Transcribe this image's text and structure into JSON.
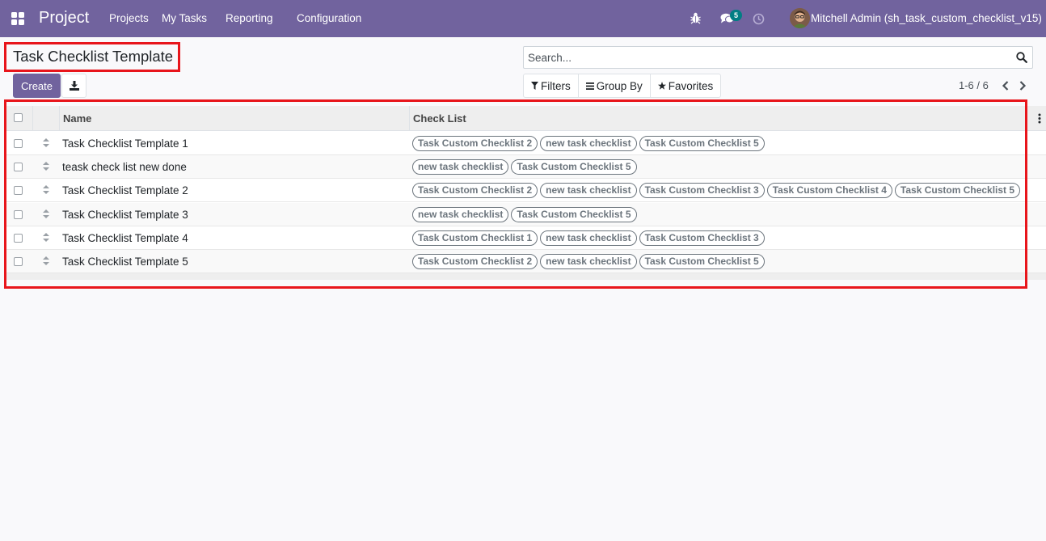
{
  "navbar": {
    "app_name": "Project",
    "menu": [
      "Projects",
      "My Tasks",
      "Reporting",
      "Configuration"
    ],
    "icons": [
      "apps-grid-icon",
      "bug-icon",
      "chat-icon",
      "clock-icon"
    ],
    "messages_badge": "5",
    "user": "Mitchell Admin (sh_task_custom_checklist_v15)",
    "bg_color": "#71639e"
  },
  "control": {
    "title": "Task Checklist Template",
    "create_label": "Create",
    "search_placeholder": "Search...",
    "filters_label": "Filters",
    "groupby_label": "Group By",
    "favorites_label": "Favorites",
    "pager": "1-6 / 6"
  },
  "table": {
    "headers": [
      "Name",
      "Check List"
    ],
    "rows": [
      {
        "name": "Task Checklist Template 1",
        "tags": [
          "Task Custom Checklist 2",
          "new task checklist",
          "Task Custom Checklist 5"
        ]
      },
      {
        "name": "teask check list new done",
        "tags": [
          "new task checklist",
          "Task Custom Checklist 5"
        ]
      },
      {
        "name": "Task Checklist Template 2",
        "tags": [
          "Task Custom Checklist 2",
          "new task checklist",
          "Task Custom Checklist 3",
          "Task Custom Checklist 4",
          "Task Custom Checklist 5"
        ]
      },
      {
        "name": "Task Checklist Template 3",
        "tags": [
          "new task checklist",
          "Task Custom Checklist 5"
        ]
      },
      {
        "name": "Task Checklist Template 4",
        "tags": [
          "Task Custom Checklist 1",
          "new task checklist",
          "Task Custom Checklist 3"
        ]
      },
      {
        "name": "Task Checklist Template 5",
        "tags": [
          "Task Custom Checklist 2",
          "new task checklist",
          "Task Custom Checklist 5"
        ]
      }
    ]
  },
  "highlight_color": "#e8151b"
}
